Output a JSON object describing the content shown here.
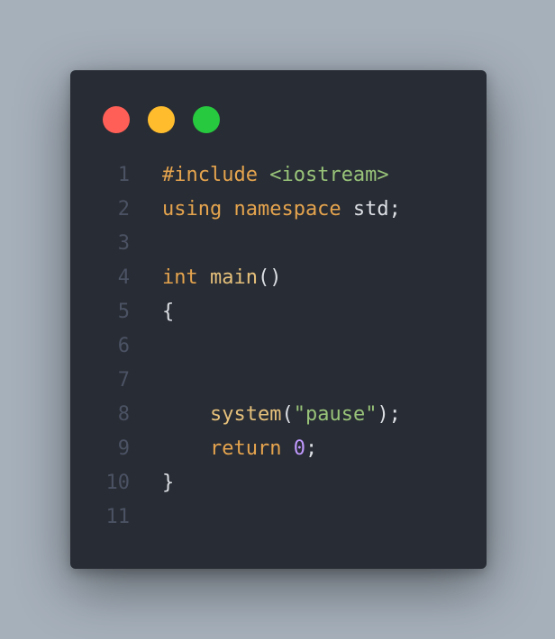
{
  "colors": {
    "background": "#a6b0bb",
    "window": "#282c34",
    "close": "#ff5f56",
    "minimize": "#ffbd2e",
    "maximize": "#27c93f"
  },
  "window_controls": [
    {
      "name": "close-button",
      "icon": "close-dot-icon",
      "color": "#ff5f56"
    },
    {
      "name": "minimize-button",
      "icon": "minimize-dot-icon",
      "color": "#ffbd2e"
    },
    {
      "name": "maximize-button",
      "icon": "maximize-dot-icon",
      "color": "#27c93f"
    }
  ],
  "code": {
    "language": "cpp",
    "lines": [
      {
        "number": "1",
        "tokens": [
          {
            "t": "#include ",
            "k": "kw"
          },
          {
            "t": "<iostream>",
            "k": "incl"
          }
        ]
      },
      {
        "number": "2",
        "tokens": [
          {
            "t": "using namespace ",
            "k": "kw"
          },
          {
            "t": "std;",
            "k": "plain"
          }
        ]
      },
      {
        "number": "3",
        "tokens": []
      },
      {
        "number": "4",
        "tokens": [
          {
            "t": "int ",
            "k": "kw"
          },
          {
            "t": "main",
            "k": "fn"
          },
          {
            "t": "()",
            "k": "plain"
          }
        ]
      },
      {
        "number": "5",
        "tokens": [
          {
            "t": "{",
            "k": "plain"
          }
        ]
      },
      {
        "number": "6",
        "tokens": []
      },
      {
        "number": "7",
        "tokens": []
      },
      {
        "number": "8",
        "tokens": [
          {
            "t": "    ",
            "k": "plain"
          },
          {
            "t": "system",
            "k": "fn"
          },
          {
            "t": "(",
            "k": "plain"
          },
          {
            "t": "\"pause\"",
            "k": "str"
          },
          {
            "t": ");",
            "k": "plain"
          }
        ]
      },
      {
        "number": "9",
        "tokens": [
          {
            "t": "    ",
            "k": "plain"
          },
          {
            "t": "return ",
            "k": "kw"
          },
          {
            "t": "0",
            "k": "num"
          },
          {
            "t": ";",
            "k": "plain"
          }
        ]
      },
      {
        "number": "10",
        "tokens": [
          {
            "t": "}",
            "k": "plain"
          }
        ]
      },
      {
        "number": "11",
        "tokens": []
      }
    ]
  }
}
